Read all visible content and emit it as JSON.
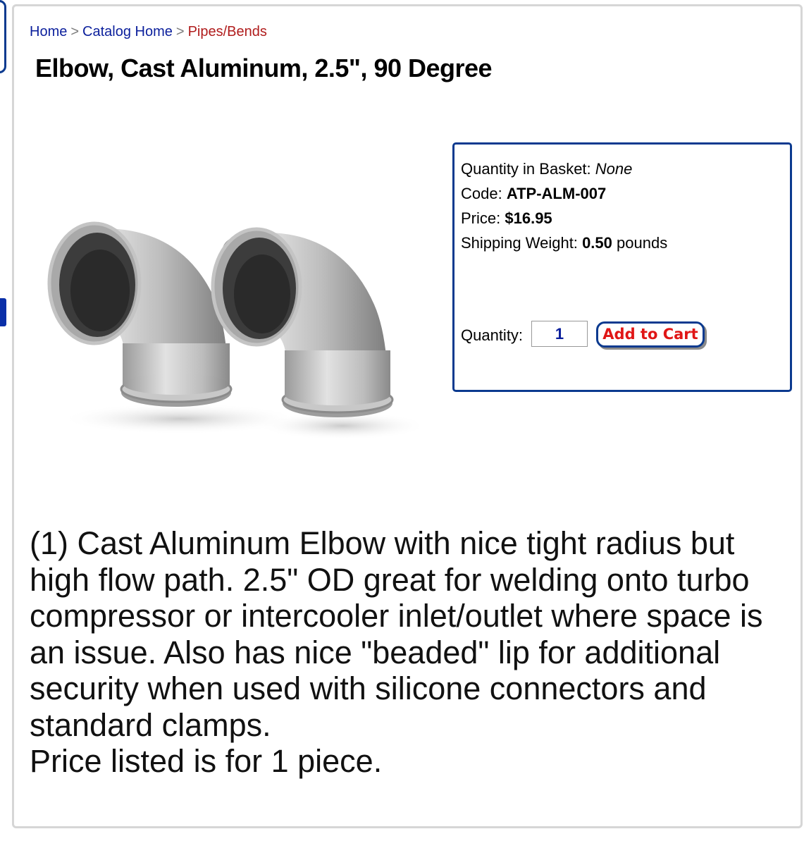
{
  "breadcrumb": {
    "home": "Home",
    "sep1": ">",
    "catalog": "Catalog Home",
    "sep2": ">",
    "current": "Pipes/Bends"
  },
  "product": {
    "title": "Elbow, Cast Aluminum, 2.5\", 90 Degree",
    "image_alt": "Two cast aluminum 90 degree elbows"
  },
  "info": {
    "basket_label": "Quantity in Basket:",
    "basket_value": "None",
    "code_label": "Code:",
    "code_value": "ATP-ALM-007",
    "price_label": "Price:",
    "price_value": "$16.95",
    "weight_label": "Shipping Weight:",
    "weight_value": "0.50",
    "weight_unit": "pounds",
    "quantity_label": "Quantity:",
    "quantity_value": "1",
    "add_to_cart": "Add to Cart"
  },
  "description": {
    "body": "(1) Cast Aluminum Elbow with nice tight radius but high flow path. 2.5\" OD great for welding onto turbo compressor or intercooler inlet/outlet where space is an issue. Also has nice \"beaded\" lip for additional security when used with silicone connectors and standard clamps.",
    "note": "Price listed is for 1 piece."
  },
  "colors": {
    "link": "#0b1f9c",
    "current_crumb": "#b01c1c",
    "box_border": "#0b3a8f",
    "cart_text": "#e01616"
  }
}
